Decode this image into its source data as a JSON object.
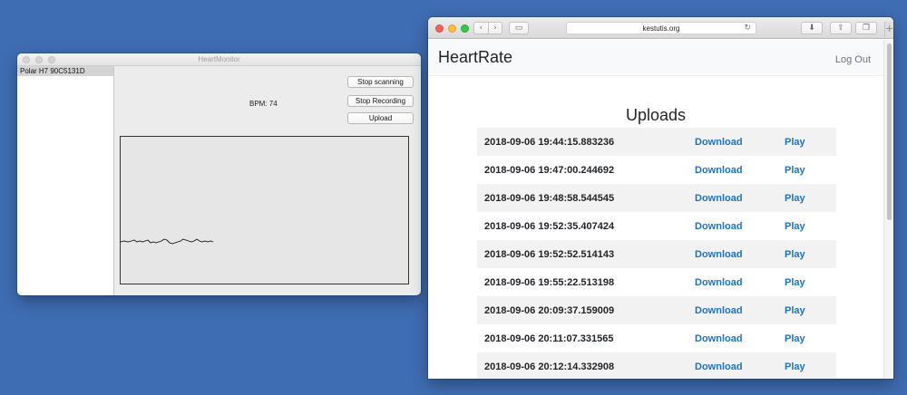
{
  "heart_monitor": {
    "window_title": "HeartMonitor",
    "device": "Polar H7 90C5131D",
    "bpm_label": "BPM: 74",
    "buttons": {
      "stop_scanning": "Stop scanning",
      "stop_recording": "Stop Recording",
      "upload": "Upload"
    }
  },
  "browser": {
    "url": "kestutis.org",
    "icons": {
      "back": "chevron-left-icon",
      "forward": "chevron-right-icon",
      "sidebar": "sidebar-icon",
      "reload": "reload-icon",
      "download": "download-icon",
      "share": "share-icon",
      "tabs": "tabs-icon",
      "new_tab": "plus-icon"
    },
    "brand": "HeartRate",
    "logout": "Log Out",
    "page_title": "Uploads",
    "uploads": [
      {
        "date": "2018-09-06 19:44:15.883236",
        "download": "Download",
        "play": "Play"
      },
      {
        "date": "2018-09-06 19:47:00.244692",
        "download": "Download",
        "play": "Play"
      },
      {
        "date": "2018-09-06 19:48:58.544545",
        "download": "Download",
        "play": "Play"
      },
      {
        "date": "2018-09-06 19:52:35.407424",
        "download": "Download",
        "play": "Play"
      },
      {
        "date": "2018-09-06 19:52:52.514143",
        "download": "Download",
        "play": "Play"
      },
      {
        "date": "2018-09-06 19:55:22.513198",
        "download": "Download",
        "play": "Play"
      },
      {
        "date": "2018-09-06 20:09:37.159009",
        "download": "Download",
        "play": "Play"
      },
      {
        "date": "2018-09-06 20:11:07.331565",
        "download": "Download",
        "play": "Play"
      },
      {
        "date": "2018-09-06 20:12:14.332908",
        "download": "Download",
        "play": "Play"
      }
    ]
  },
  "colors": {
    "desktop": "#3f6db3",
    "link": "#1a73c9",
    "row_stripe": "#f2f2f2"
  }
}
